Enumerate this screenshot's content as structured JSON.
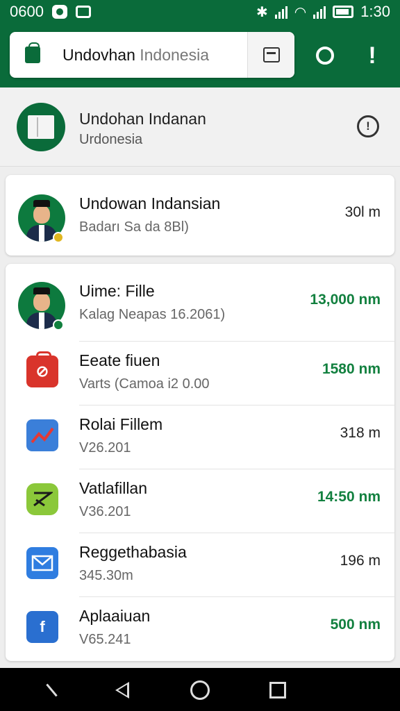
{
  "status_bar": {
    "left_text": "0600",
    "time": "1:30"
  },
  "search": {
    "query_main": "Undovhan",
    "query_muted": "Indonesia"
  },
  "header": {
    "title": "Undohan Indanan",
    "subtitle": "Urdonesia"
  },
  "featured": {
    "title": "Undowan Indansian",
    "subtitle": "Badarı Sa da 8Bl)",
    "size": "30l m",
    "status_color": "#e0b620"
  },
  "items": [
    {
      "title": "Uime: Fille",
      "subtitle": "Kalag Neapas 16.2061)",
      "size": "13,000 nm",
      "size_green": true,
      "icon": "avatar-icon"
    },
    {
      "title": "Eeate fiuen",
      "subtitle": "Varts (Camoa i2 0.00",
      "size": "1580 nm",
      "size_green": true,
      "icon": "shopping-bag-icon"
    },
    {
      "title": "Rolai Fillem",
      "subtitle": "V26.201",
      "size": "318 m",
      "size_green": false,
      "icon": "chart-icon"
    },
    {
      "title": "Vatlafillan",
      "subtitle": "V36.201",
      "size": "14:50 nm",
      "size_green": true,
      "icon": "ticket-icon"
    },
    {
      "title": "Reggethabasia",
      "subtitle": "345.30m",
      "size": "196 m",
      "size_green": false,
      "icon": "mail-icon"
    },
    {
      "title": "Aplaaiuan",
      "subtitle": "V65.241",
      "size": "500 nm",
      "size_green": true,
      "icon": "facebook-icon"
    }
  ],
  "colors": {
    "brand": "#0a6b3a",
    "accent_green": "#12803f"
  }
}
